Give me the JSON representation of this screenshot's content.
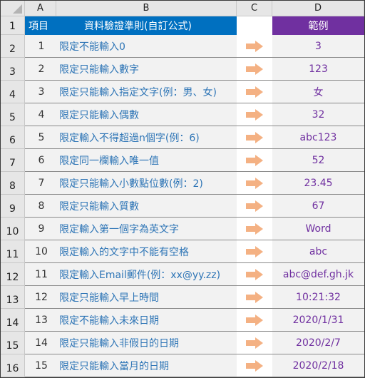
{
  "column_headers": [
    "A",
    "B",
    "C",
    "D"
  ],
  "row_numbers": [
    "1",
    "2",
    "3",
    "4",
    "5",
    "6",
    "7",
    "8",
    "9",
    "10",
    "11",
    "12",
    "13",
    "14",
    "15",
    "16"
  ],
  "header": {
    "item_label": "項目",
    "rule_label": "資料驗證準則(自訂公式)",
    "arrow_col": "",
    "example_label": "範例"
  },
  "colors": {
    "header_blue": "#0070c0",
    "header_purple": "#7030a0",
    "rule_text": "#2e75b6",
    "example_text": "#7030a0",
    "arrow": "#f4b183"
  },
  "rows": [
    {
      "item": "1",
      "rule": "限定不能輸入0",
      "arrow_icon": "right-arrow-icon",
      "example": "3"
    },
    {
      "item": "2",
      "rule": "限定只能輸入數字",
      "arrow_icon": "right-arrow-icon",
      "example": "123"
    },
    {
      "item": "3",
      "rule": "限定只能輸入指定文字(例：男、女)",
      "arrow_icon": "right-arrow-icon",
      "example": "女"
    },
    {
      "item": "4",
      "rule": "限定只能輸入偶數",
      "arrow_icon": "right-arrow-icon",
      "example": "32"
    },
    {
      "item": "5",
      "rule": "限定輸入不得超過n個字(例：6)",
      "arrow_icon": "right-arrow-icon",
      "example": "abc123"
    },
    {
      "item": "6",
      "rule": "限定同一欄輸入唯一值",
      "arrow_icon": "right-arrow-icon",
      "example": "52"
    },
    {
      "item": "7",
      "rule": "限定只能輸入小數點位數(例：2)",
      "arrow_icon": "right-arrow-icon",
      "example": "23.45"
    },
    {
      "item": "8",
      "rule": "限定只能輸入質數",
      "arrow_icon": "right-arrow-icon",
      "example": "67"
    },
    {
      "item": "9",
      "rule": "限定輸入第一個字為英文字",
      "arrow_icon": "right-arrow-icon",
      "example": "Word"
    },
    {
      "item": "10",
      "rule": "限定輸入的文字中不能有空格",
      "arrow_icon": "right-arrow-icon",
      "example": "abc"
    },
    {
      "item": "11",
      "rule": "限定輸入Email郵件(例：xx@yy.zz)",
      "arrow_icon": "right-arrow-icon",
      "example": "abc@def.gh.jk"
    },
    {
      "item": "12",
      "rule": "限定只能輸入早上時間",
      "arrow_icon": "right-arrow-icon",
      "example": "10:21:32"
    },
    {
      "item": "13",
      "rule": "限定不能輸入未來日期",
      "arrow_icon": "right-arrow-icon",
      "example": "2020/1/31"
    },
    {
      "item": "14",
      "rule": "限定只能輸入非假日的日期",
      "arrow_icon": "right-arrow-icon",
      "example": "2020/2/7"
    },
    {
      "item": "15",
      "rule": "限定只能輸入當月的日期",
      "arrow_icon": "right-arrow-icon",
      "example": "2020/2/18"
    }
  ]
}
